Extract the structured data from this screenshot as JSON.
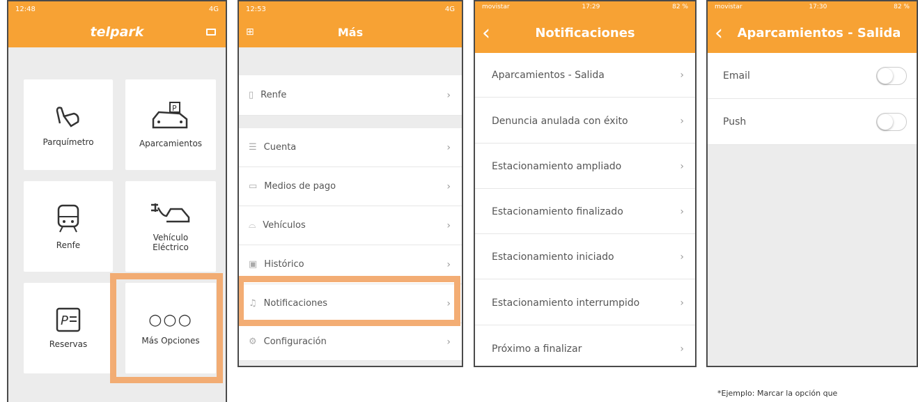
{
  "p1": {
    "status": {
      "time": "12:48",
      "net": "4G"
    },
    "brand": "telpark",
    "tiles": [
      "Parquímetro",
      "Aparcamientos",
      "Renfe",
      "Vehículo\nEléctrico",
      "Reservas",
      "Más Opciones"
    ]
  },
  "p2": {
    "status": {
      "time": "12:53",
      "net": "4G"
    },
    "title": "Más",
    "items": [
      "Renfe",
      "Cuenta",
      "Medios de pago",
      "Vehículos",
      "Histórico",
      "Notificaciones",
      "Configuración"
    ]
  },
  "p3": {
    "status": {
      "carrier": "movistar",
      "time": "17:29",
      "batt": "82 %"
    },
    "title": "Notificaciones",
    "items": [
      "Aparcamientos - Salida",
      "Denuncia anulada con éxito",
      "Estacionamiento ampliado",
      "Estacionamiento finalizado",
      "Estacionamiento iniciado",
      "Estacionamiento interrumpido",
      "Próximo a finalizar"
    ]
  },
  "p4": {
    "status": {
      "carrier": "movistar",
      "time": "17:30",
      "batt": "82 %"
    },
    "title": "Aparcamientos - Salida",
    "items": [
      "Email",
      "Push"
    ]
  },
  "caption": "*Ejemplo: Marcar la opción que",
  "colors": {
    "accent": "#f7a234",
    "highlight": "#f2a96d"
  }
}
